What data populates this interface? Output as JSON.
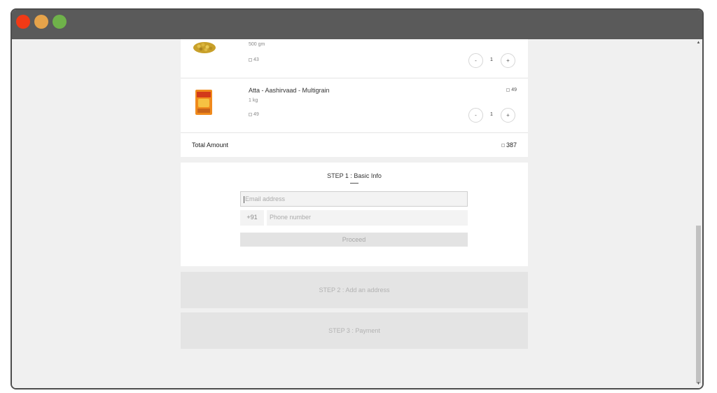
{
  "cart": {
    "items": [
      {
        "name": "",
        "weight": "500 gm",
        "unit_price": "43",
        "line_total": "",
        "qty": "1",
        "minus": "-",
        "plus": "+"
      },
      {
        "name": "Atta - Aashirvaad - Multigrain",
        "weight": "1 kg",
        "unit_price": "49",
        "line_total": "49",
        "qty": "1",
        "minus": "-",
        "plus": "+"
      }
    ],
    "total_label": "Total Amount",
    "total_value": "387"
  },
  "step1": {
    "title": "STEP 1 : Basic Info",
    "email_placeholder": "Email address",
    "country_code": "+91",
    "phone_placeholder": "Phone number",
    "proceed_label": "Proceed"
  },
  "step2": {
    "title": "STEP 2 : Add an address"
  },
  "step3": {
    "title": "STEP 3 : Payment"
  },
  "scrollbar": {
    "up": "▲",
    "down": "▼"
  }
}
